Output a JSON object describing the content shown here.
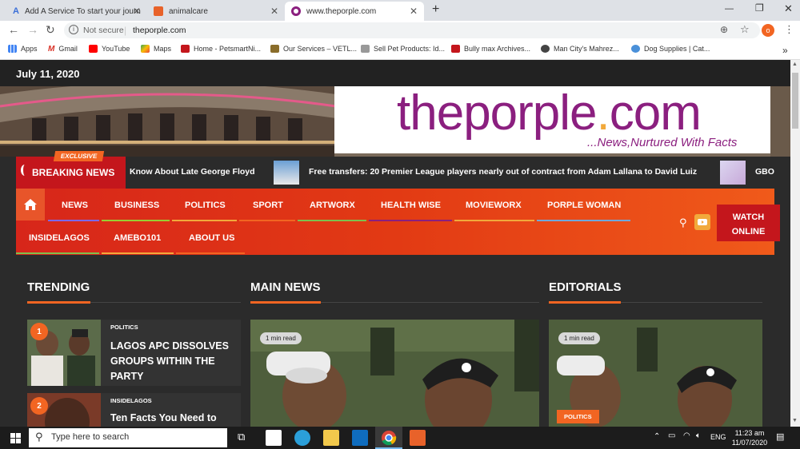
{
  "browser": {
    "tabs": [
      {
        "title": "Add A Service To start your journ",
        "active": false
      },
      {
        "title": "animalcare",
        "active": false
      },
      {
        "title": "www.theporple.com",
        "active": true
      }
    ],
    "security": "Not secure",
    "url": "theporple.com",
    "profile_initial": "o",
    "bookmarks": [
      "Apps",
      "Gmail",
      "YouTube",
      "Maps",
      "Home - PetsmartNi...",
      "Our Services – VETL...",
      "Sell Pet Products: Id...",
      "Bully max Archives...",
      "Man City's Mahrez...",
      "Dog Supplies | Cat..."
    ],
    "more": "»"
  },
  "site": {
    "date": "July 11, 2020",
    "logo": {
      "name": "theporple",
      "dot": ".",
      "tld": "com",
      "tagline": "...News,Nurtured With Facts"
    },
    "breaking": {
      "badge": "EXCLUSIVE",
      "label": "BREAKING NEWS",
      "items": [
        "Know About Late George Floyd",
        "Free transfers: 20 Premier League players nearly out of contract from Adam Lallana to David Luiz",
        "GBO"
      ]
    },
    "nav": {
      "row1": [
        "NEWS",
        "BUSINESS",
        "POLITICS",
        "SPORT",
        "ARTWORX",
        "HEALTH WISE",
        "MOVIEWORX",
        "PORPLE WOMAN"
      ],
      "row2": [
        "INSIDELAGOS",
        "AMEBO101",
        "ABOUT US"
      ],
      "watch": [
        "WATCH",
        "ONLINE"
      ]
    },
    "sections": {
      "trending": "TRENDING",
      "main": "MAIN NEWS",
      "editorials": "EDITORIALS"
    },
    "trending": [
      {
        "num": "1",
        "category": "POLITICS",
        "headline": [
          "LAGOS APC DISSOLVES",
          "GROUPS WITHIN THE",
          "PARTY"
        ]
      },
      {
        "num": "2",
        "category": "INSIDELAGOS",
        "headline": [
          "Ten Facts You Need to"
        ]
      }
    ],
    "main_card": {
      "read": "1 min read"
    },
    "editorial_card": {
      "read": "1 min read",
      "category": "POLITICS"
    }
  },
  "taskbar": {
    "search": "Type here to search",
    "lang": "ENG",
    "time": "11:23 am",
    "date": "11/07/2020"
  },
  "colors": {
    "accent": "#f26522",
    "brand": "#8b1f7f",
    "breaking_red": "#c4161c"
  }
}
